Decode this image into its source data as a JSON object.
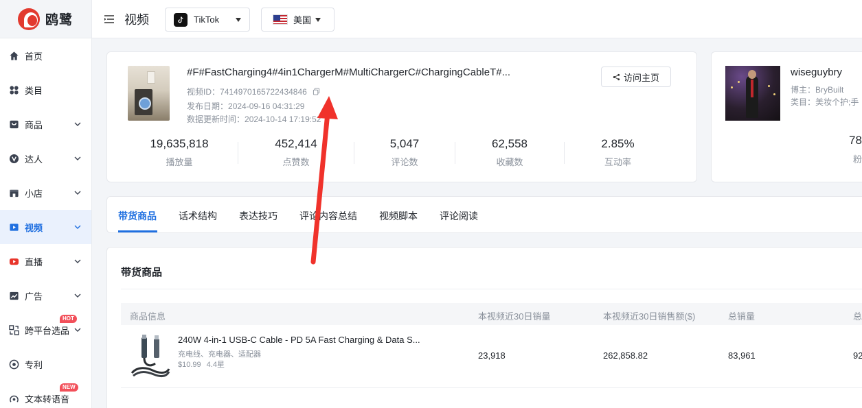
{
  "brand": {
    "name": "鸥鹭"
  },
  "sidebar": {
    "items": [
      {
        "label": "首页",
        "icon": "home-icon",
        "chevron": false,
        "active": false
      },
      {
        "label": "类目",
        "icon": "grid-icon",
        "chevron": false,
        "active": false
      },
      {
        "label": "商品",
        "icon": "bag-icon",
        "chevron": true,
        "active": false
      },
      {
        "label": "达人",
        "icon": "v-badge-icon",
        "chevron": true,
        "active": false
      },
      {
        "label": "小店",
        "icon": "store-icon",
        "chevron": true,
        "active": false
      },
      {
        "label": "视频",
        "icon": "video-icon",
        "chevron": true,
        "active": true
      },
      {
        "label": "直播",
        "icon": "live-icon",
        "chevron": true,
        "active": false
      },
      {
        "label": "广告",
        "icon": "chart-line-icon",
        "chevron": true,
        "active": false
      },
      {
        "label": "跨平台选品",
        "icon": "cross-platform-icon",
        "chevron": true,
        "active": false,
        "badge": "HOT"
      },
      {
        "label": "专利",
        "icon": "patent-icon",
        "chevron": false,
        "active": false
      },
      {
        "label": "文本转语音",
        "icon": "text-to-speech-icon",
        "chevron": false,
        "active": false,
        "badge": "NEW"
      }
    ]
  },
  "header": {
    "title": "视频",
    "platform": "TikTok",
    "country": "美国"
  },
  "video": {
    "title": "#F#FastCharging4#4in1ChargerM#MultiChargerC#ChargingCableT#...",
    "id_label": "视频ID：",
    "id_value": "7414970165722434846",
    "publish_label": "发布日期：",
    "publish_value": "2024-09-16 04:31:29",
    "update_label": "数据更新时间：",
    "update_value": "2024-10-14 17:19:52",
    "visit_button": "访问主页",
    "stats": [
      {
        "value": "19,635,818",
        "label": "播放量"
      },
      {
        "value": "452,414",
        "label": "点赞数"
      },
      {
        "value": "5,047",
        "label": "评论数"
      },
      {
        "value": "62,558",
        "label": "收藏数"
      },
      {
        "value": "2.85%",
        "label": "互动率"
      }
    ]
  },
  "creator": {
    "name": "wiseguybry",
    "owner_label": "博主：",
    "owner_value": "BryBuilt",
    "category_label": "类目：",
    "category_value": "美妆个护;手",
    "followers_value": "78",
    "followers_label": "粉"
  },
  "tabs": [
    {
      "label": "带货商品",
      "active": true
    },
    {
      "label": "话术结构",
      "active": false
    },
    {
      "label": "表达技巧",
      "active": false
    },
    {
      "label": "评论内容总结",
      "active": false
    },
    {
      "label": "视频脚本",
      "active": false
    },
    {
      "label": "评论阅读",
      "active": false
    }
  ],
  "goods": {
    "section_title": "带货商品",
    "columns": [
      "商品信息",
      "本视频近30日销量",
      "本视频近30日销售额($)",
      "总销量",
      "总"
    ],
    "rows": [
      {
        "title": "240W 4-in-1 USB-C Cable - PD 5A Fast Charging & Data S...",
        "category": "充电线、充电器、适配器",
        "price": "$10.99",
        "rating": "4.4星",
        "sales_30d": "23,918",
        "revenue_30d": "262,858.82",
        "total_sales": "83,961",
        "total_partial": "92"
      }
    ]
  },
  "colors": {
    "accent": "#1f6fe0",
    "brand_red": "#e23a2f",
    "annotation_arrow": "#f0322b",
    "hot_badge": "#f2505a"
  }
}
